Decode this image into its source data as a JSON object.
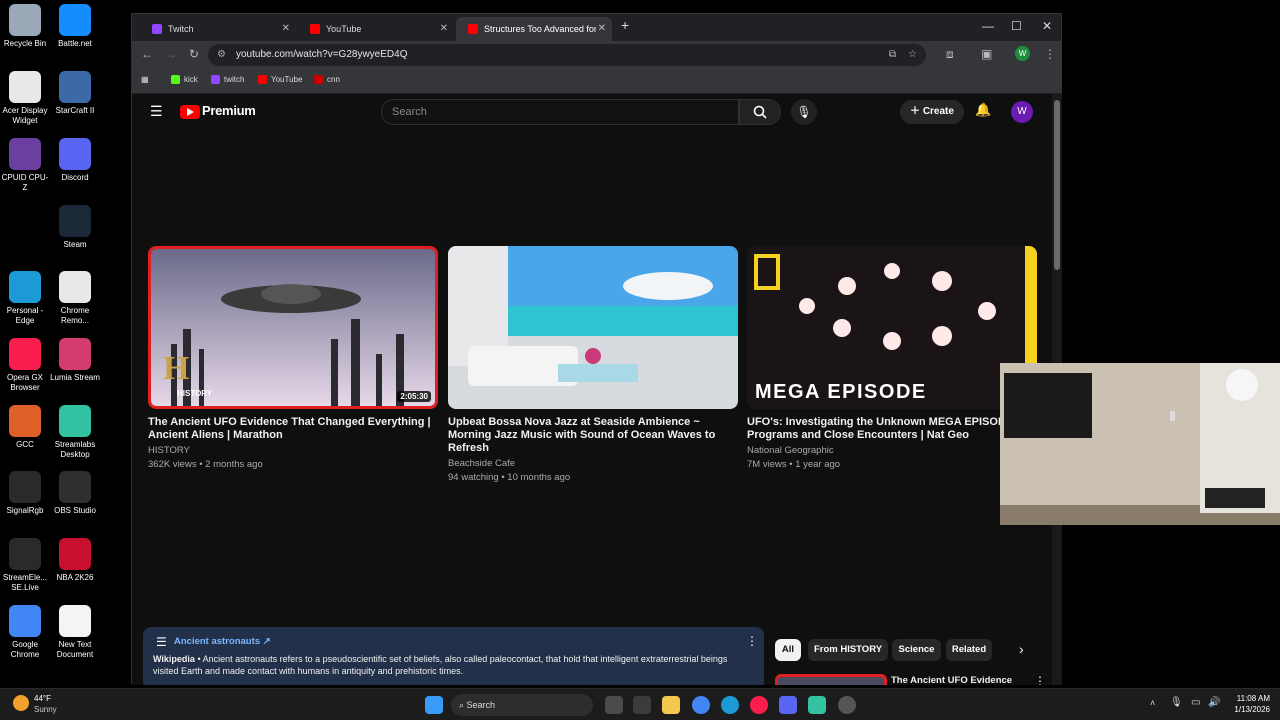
{
  "desktop": {
    "icons": [
      {
        "label": "Recycle Bin",
        "color": "#9aa8b8"
      },
      {
        "label": "Battle.net",
        "color": "#148eff"
      },
      {
        "label": "Acer Display Widget",
        "color": "#e8e8e8"
      },
      {
        "label": "StarCraft II",
        "color": "#3c6aa8"
      },
      {
        "label": "CPUID CPU-Z",
        "color": "#6b3fa0"
      },
      {
        "label": "Discord",
        "color": "#5865f2"
      },
      {
        "label": "Steam",
        "color": "#1b2838"
      },
      {
        "label": "Personal - Edge",
        "color": "#1b9ad6"
      },
      {
        "label": "Chrome Remo...",
        "color": "#e8e8e8"
      },
      {
        "label": "Opera GX Browser",
        "color": "#fa1e4e"
      },
      {
        "label": "Lumia Stream",
        "color": "#d23c6e"
      },
      {
        "label": "GCC",
        "color": "#e0602a"
      },
      {
        "label": "Streamlabs Desktop",
        "color": "#31c3a2"
      },
      {
        "label": "SignalRgb",
        "color": "#2a2a2a"
      },
      {
        "label": "OBS Studio",
        "color": "#302e31"
      },
      {
        "label": "StreamEle... SE.Live",
        "color": "#2a2a2a"
      },
      {
        "label": "NBA 2K26",
        "color": "#c8102e"
      },
      {
        "label": "Google Chrome",
        "color": "#4285f4"
      },
      {
        "label": "New Text Document",
        "color": "#f4f4f4"
      }
    ]
  },
  "browser": {
    "tabs": [
      {
        "label": "Twitch",
        "color": "#9146ff"
      },
      {
        "label": "YouTube",
        "color": "#ff0000"
      },
      {
        "label": "Structures Too Advanced for Th",
        "color": "#ff0000"
      }
    ],
    "url": "youtube.com/watch?v=G28ywyeED4Q",
    "bookmarks": [
      {
        "label": "kick",
        "color": "#53fc18"
      },
      {
        "label": "twitch",
        "color": "#9146ff"
      },
      {
        "label": "YouTube",
        "color": "#ff0000"
      },
      {
        "label": "cnn",
        "color": "#cc0000"
      }
    ],
    "profile_initial": "W"
  },
  "youtube": {
    "logo_text": "Premium",
    "search_placeholder": "Search",
    "create_label": "Create",
    "avatar_initial": "W",
    "videos": [
      {
        "title": "The Ancient UFO Evidence That Changed Everything | Ancient Aliens | Marathon",
        "channel": "HISTORY",
        "meta": "362K views • 2 months ago",
        "duration": "2:05:30",
        "badge": "HISTORY"
      },
      {
        "title": "Upbeat Bossa Nova Jazz at Seaside Ambience ~ Morning Jazz Music with Sound of Ocean Waves to Refresh",
        "channel": "Beachside Cafe",
        "meta": "94 watching • 10 months ago",
        "duration": "",
        "badge": ""
      },
      {
        "title": "UFO's: Investigating the Unknown MEGA EPISODE | S Programs and Close Encounters | Nat Geo",
        "channel": "National Geographic",
        "meta": "7M views • 1 year ago",
        "duration": "",
        "badge": "MEGA EPISODE"
      }
    ],
    "info_panel": {
      "topic": "Ancient astronauts",
      "source": "Wikipedia",
      "text": "• Ancient astronauts refers to a pseudoscientific set of beliefs, also called paleocontact, that hold that intelligent extraterrestrial beings visited Earth and made contact with humans in antiquity and prehistoric times."
    },
    "chips": [
      "All",
      "From HISTORY",
      "Science",
      "Related"
    ],
    "related_title": "The Ancient UFO Evidence That Changed Everything | Ancient"
  },
  "taskbar": {
    "weather_temp": "44°F",
    "weather_desc": "Sunny",
    "search_label": "Search",
    "time": "11:08 AM",
    "date": "1/13/2026"
  }
}
